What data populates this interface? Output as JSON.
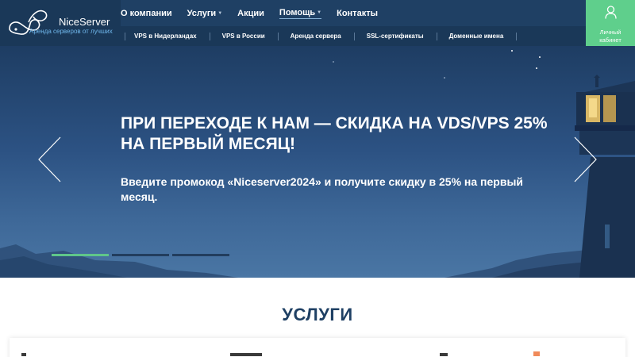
{
  "brand": {
    "name": "NiceServer",
    "tagline": "Аренда серверов от лучших"
  },
  "nav": {
    "items": [
      {
        "label": "О компании",
        "dropdown": false,
        "active": false
      },
      {
        "label": "Услуги",
        "dropdown": true,
        "active": false
      },
      {
        "label": "Акции",
        "dropdown": false,
        "active": false
      },
      {
        "label": "Помощь",
        "dropdown": true,
        "active": true
      },
      {
        "label": "Контакты",
        "dropdown": false,
        "active": false
      }
    ],
    "subitems": [
      "VPS в Нидерландах",
      "VPS в России",
      "Аренда сервера",
      "SSL-сертификаты",
      "Доменные имена"
    ]
  },
  "account": {
    "label_line1": "Личный",
    "label_line2": "кабинет",
    "icon": "user-icon"
  },
  "hero": {
    "title": "ПРИ ПЕРЕХОДЕ К НАМ — СКИДКА НА VDS/VPS 25% НА ПЕРВЫЙ МЕСЯЦ!",
    "subtitle": "Введите промокод «Niceserver2024» и получите скидку в 25% на первый месяц.",
    "slides_total": 3,
    "active_slide": 1
  },
  "services": {
    "title": "УСЛУГИ"
  },
  "colors": {
    "header": "#1f4064",
    "subnav": "#1a3858",
    "accent_green": "#5fcf8c",
    "tagline_blue": "#6fb6ea",
    "title_navy": "#1f4064"
  }
}
